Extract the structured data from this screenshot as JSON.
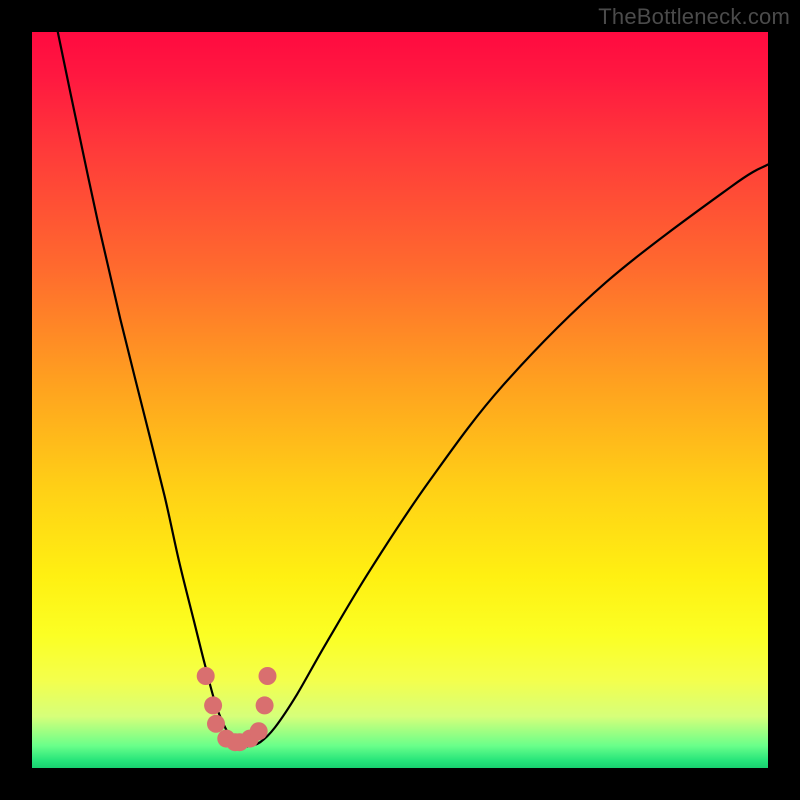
{
  "watermark": "TheBottleneck.com",
  "chart_data": {
    "type": "line",
    "title": "",
    "xlabel": "",
    "ylabel": "",
    "xlim": [
      0,
      100
    ],
    "ylim": [
      0,
      100
    ],
    "gradient_stops": [
      {
        "offset": 0,
        "color": "#ff0a40"
      },
      {
        "offset": 6,
        "color": "#ff1840"
      },
      {
        "offset": 16,
        "color": "#ff3a3a"
      },
      {
        "offset": 32,
        "color": "#ff6a2e"
      },
      {
        "offset": 48,
        "color": "#ffa21f"
      },
      {
        "offset": 62,
        "color": "#ffd016"
      },
      {
        "offset": 74,
        "color": "#fff012"
      },
      {
        "offset": 82,
        "color": "#fbff24"
      },
      {
        "offset": 88,
        "color": "#f4ff4c"
      },
      {
        "offset": 93,
        "color": "#d6ff7a"
      },
      {
        "offset": 97,
        "color": "#69ff8a"
      },
      {
        "offset": 99,
        "color": "#26e47a"
      },
      {
        "offset": 100,
        "color": "#18d070"
      }
    ],
    "series": [
      {
        "name": "bottleneck-curve",
        "x": [
          3.5,
          6,
          9,
          12,
          15,
          18,
          20,
          22,
          23.5,
          25,
          26.5,
          28,
          29.5,
          31,
          33,
          36,
          40,
          46,
          54,
          64,
          78,
          95,
          100
        ],
        "y": [
          100,
          88,
          74,
          61,
          49,
          37,
          28,
          20,
          14,
          8.5,
          5,
          3,
          3,
          3.5,
          5.5,
          10,
          17,
          27,
          39,
          52,
          66,
          79,
          82
        ]
      }
    ],
    "points": [
      {
        "x": 23.6,
        "y": 12.5
      },
      {
        "x": 24.6,
        "y": 8.5
      },
      {
        "x": 25.0,
        "y": 6.0
      },
      {
        "x": 26.4,
        "y": 4.0
      },
      {
        "x": 27.6,
        "y": 3.5
      },
      {
        "x": 28.2,
        "y": 3.5
      },
      {
        "x": 29.6,
        "y": 4.0
      },
      {
        "x": 30.8,
        "y": 5.0
      },
      {
        "x": 31.6,
        "y": 8.5
      },
      {
        "x": 32.0,
        "y": 12.5
      }
    ],
    "point_color": "#d96f6f",
    "curve_color": "#000000"
  }
}
